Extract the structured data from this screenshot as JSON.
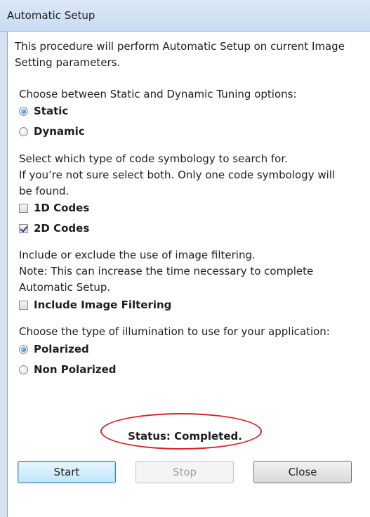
{
  "window": {
    "title": "Automatic Setup"
  },
  "intro": {
    "line1": "This procedure will perform Automatic Setup on current Image",
    "line2": "Setting parameters."
  },
  "tuning": {
    "prompt": "Choose between Static and Dynamic Tuning options:",
    "options": [
      {
        "label": "Static",
        "selected": true
      },
      {
        "label": "Dynamic",
        "selected": false
      }
    ]
  },
  "symbology": {
    "prompt_line1": "Select which type of code symbology to search for.",
    "prompt_line2": "If you’re not sure select both. Only one code symbology will",
    "prompt_line3": "be found.",
    "options": [
      {
        "label": "1D Codes",
        "checked": false
      },
      {
        "label": "2D Codes",
        "checked": true
      }
    ]
  },
  "filtering": {
    "prompt_line1": "Include or exclude the use of image filtering.",
    "prompt_line2": "Note: This can increase the time necessary to complete",
    "prompt_line3": "Automatic Setup.",
    "option": {
      "label": "Include Image Filtering",
      "checked": false
    }
  },
  "illumination": {
    "prompt": "Choose the type of illumination to use for your application:",
    "options": [
      {
        "label": "Polarized",
        "selected": true
      },
      {
        "label": "Non Polarized",
        "selected": false
      }
    ]
  },
  "status": {
    "text": "Status: Completed."
  },
  "buttons": {
    "start": {
      "label": "Start",
      "enabled": true
    },
    "stop": {
      "label": "Stop",
      "enabled": false
    },
    "close": {
      "label": "Close",
      "enabled": true
    }
  },
  "colors": {
    "annotation_ring": "#d8262a",
    "radio_selected": "#1d6fc0"
  }
}
